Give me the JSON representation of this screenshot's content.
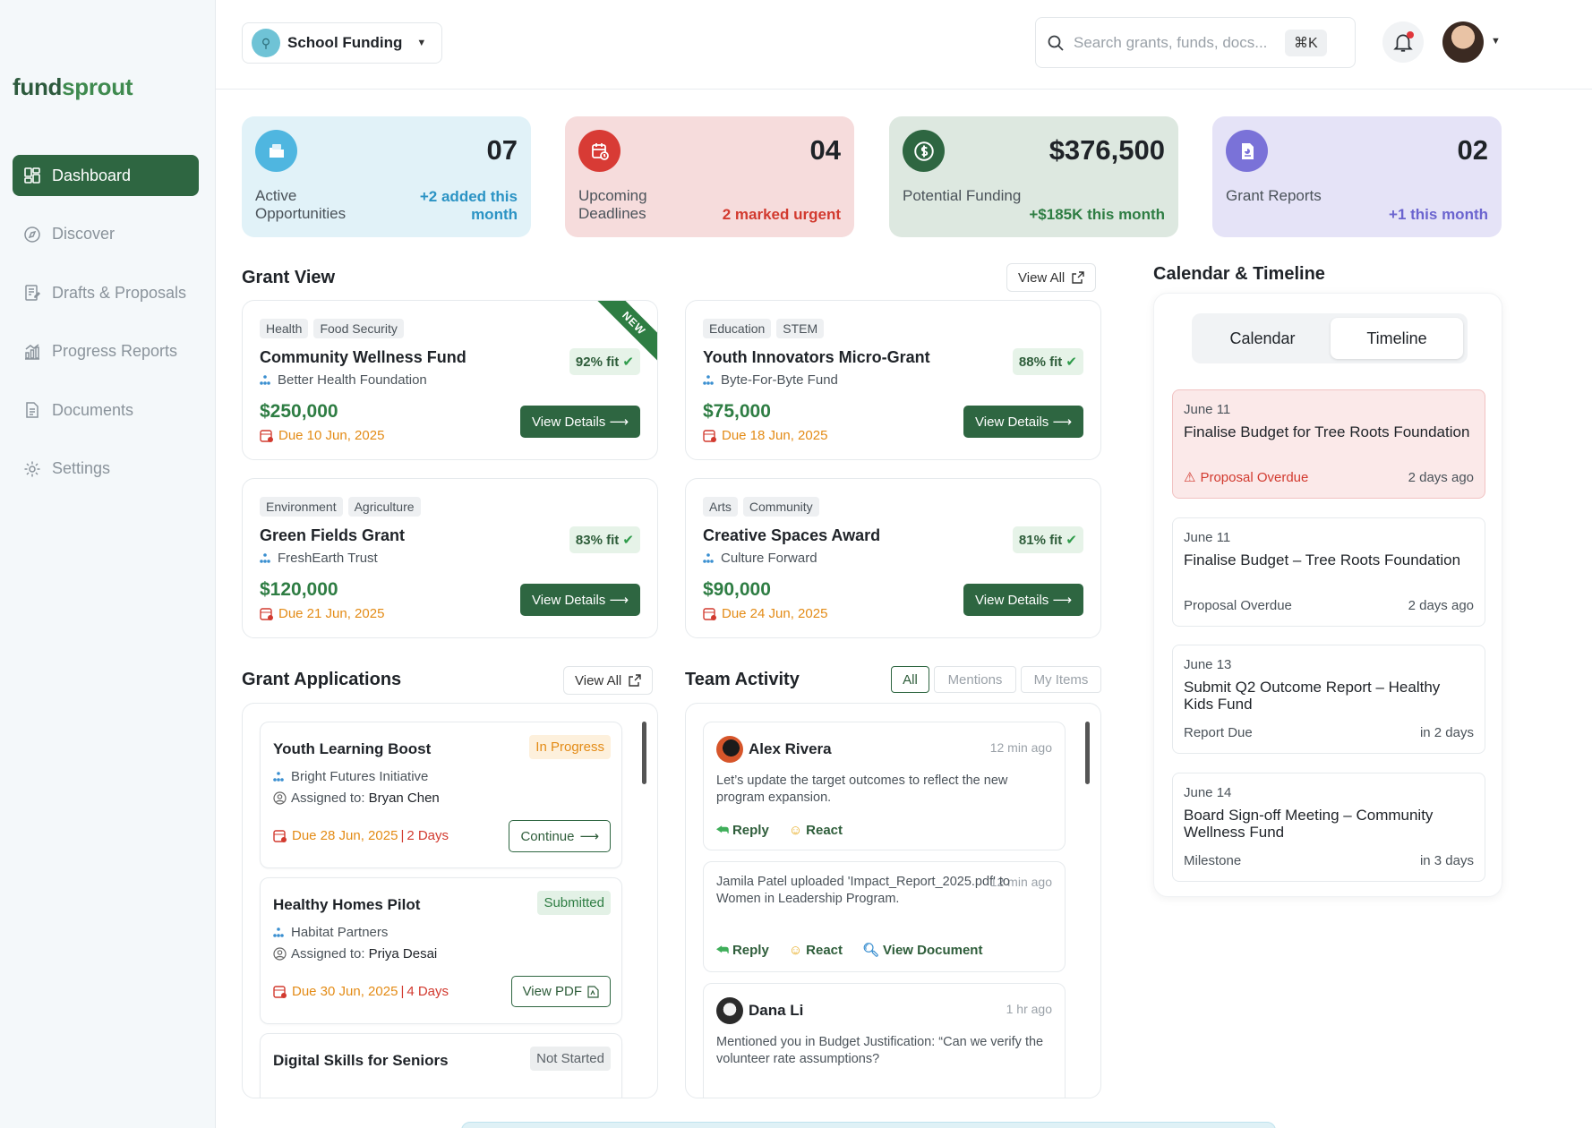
{
  "brand": {
    "part1": "fund",
    "part2": "sprout"
  },
  "nav": [
    {
      "label": "Dashboard",
      "icon": "dashboard-icon",
      "active": true
    },
    {
      "label": "Discover",
      "icon": "compass-icon"
    },
    {
      "label": "Drafts & Proposals",
      "icon": "drafts-icon"
    },
    {
      "label": "Progress Reports",
      "icon": "chart-icon"
    },
    {
      "label": "Documents",
      "icon": "document-icon"
    },
    {
      "label": "Settings",
      "icon": "gear-icon"
    }
  ],
  "topbar": {
    "workspace": "School Funding",
    "search_placeholder": "Search grants, funds, docs...",
    "shortcut": "⌘K"
  },
  "stats": [
    {
      "value": "07",
      "label": "Active Opportunities",
      "delta": "+2 added this month",
      "bg": "#e1f2f8",
      "icon_bg": "#4fb6e0",
      "delta_color": "#2b93c4",
      "icon": "folder-icon"
    },
    {
      "value": "04",
      "label": "Upcoming Deadlines",
      "delta": "2 marked urgent",
      "bg": "#f6dcdc",
      "icon_bg": "#d83b35",
      "delta_color": "#d23a2f",
      "icon": "calendar-clock-icon"
    },
    {
      "value": "$376,500",
      "label": "Potential Funding",
      "delta": "+$185K this month",
      "bg": "#dde8e0",
      "icon_bg": "#2e6641",
      "delta_color": "#2e7d43",
      "icon": "dollar-icon"
    },
    {
      "value": "02",
      "label": "Grant Reports",
      "delta": "+1 this month",
      "bg": "#e5e3f7",
      "icon_bg": "#7a72d8",
      "delta_color": "#6b64cf",
      "icon": "report-icon"
    }
  ],
  "grant_view": {
    "title": "Grant View",
    "view_all": "View All",
    "cards": [
      {
        "tags": [
          "Health",
          "Food Security"
        ],
        "title": "Community Wellness Fund",
        "org": "Better Health Foundation",
        "amount": "$250,000",
        "due": "Due 10 Jun, 2025",
        "fit": "92% fit",
        "ribbon": "NEW",
        "cta": "View Details"
      },
      {
        "tags": [
          "Education",
          "STEM"
        ],
        "title": "Youth Innovators Micro-Grant",
        "org": "Byte-For-Byte Fund",
        "amount": "$75,000",
        "due": "Due 18 Jun, 2025",
        "fit": "88% fit",
        "cta": "View Details"
      },
      {
        "tags": [
          "Environment",
          "Agriculture"
        ],
        "title": "Green Fields Grant",
        "org": "FreshEarth Trust",
        "amount": "$120,000",
        "due": "Due 21 Jun, 2025",
        "fit": "83% fit",
        "cta": "View Details"
      },
      {
        "tags": [
          "Arts",
          "Community"
        ],
        "title": "Creative Spaces Award",
        "org": "Culture Forward",
        "amount": "$90,000",
        "due": "Due 24 Jun, 2025",
        "fit": "81% fit",
        "cta": "View Details"
      }
    ]
  },
  "applications": {
    "title": "Grant Applications",
    "view_all": "View All",
    "assigned_prefix": "Assigned to:",
    "items": [
      {
        "title": "Youth Learning Boost",
        "status": "In Progress",
        "org": "Bright Futures Initiative",
        "assignee": "Bryan Chen",
        "due": "Due 28 Jun, 2025",
        "sep": "|",
        "days": "2 Days",
        "action": "Continue"
      },
      {
        "title": "Healthy Homes Pilot",
        "status": "Submitted",
        "org": "Habitat Partners",
        "assignee": "Priya Desai",
        "due": "Due 30 Jun, 2025",
        "sep": "|",
        "days": "4 Days",
        "action": "View PDF"
      },
      {
        "title": "Digital Skills for Seniors",
        "status": "Not Started"
      }
    ]
  },
  "team_activity": {
    "title": "Team Activity",
    "filters": [
      "All",
      "Mentions",
      "My Items"
    ],
    "items": [
      {
        "name": "Alex Rivera",
        "time": "12 min ago",
        "message": "Let’s update the target outcomes to reflect the new program expansion.",
        "actions": [
          "Reply",
          "React"
        ]
      },
      {
        "time": "12 min ago",
        "message": "Jamila Patel uploaded 'Impact_Report_2025.pdf' to Women in Leadership Program.",
        "actions": [
          "Reply",
          "React",
          "View Document"
        ]
      },
      {
        "name": "Dana Li",
        "time": "1 hr ago",
        "message": "Mentioned you in Budget Justification: “Can we verify the volunteer rate assumptions?"
      }
    ]
  },
  "calendar": {
    "title": "Calendar & Timeline",
    "tabs": [
      "Calendar",
      "Timeline"
    ],
    "events": [
      {
        "date": "June 11",
        "title": "Finalise Budget for Tree Roots Foundation",
        "status": "Proposal Overdue",
        "ago": "2 days ago",
        "alert": true
      },
      {
        "date": "June 11",
        "title": "Finalise Budget – Tree Roots Foundation",
        "status": "Proposal Overdue",
        "ago": "2 days ago"
      },
      {
        "date": "June 13",
        "title": "Submit Q2 Outcome Report – Healthy Kids Fund",
        "status": "Report Due",
        "ago": "in 2 days"
      },
      {
        "date": "June 14",
        "title": "Board Sign-off Meeting – Community Wellness Fund",
        "status": "Milestone",
        "ago": "in 3 days"
      }
    ]
  }
}
